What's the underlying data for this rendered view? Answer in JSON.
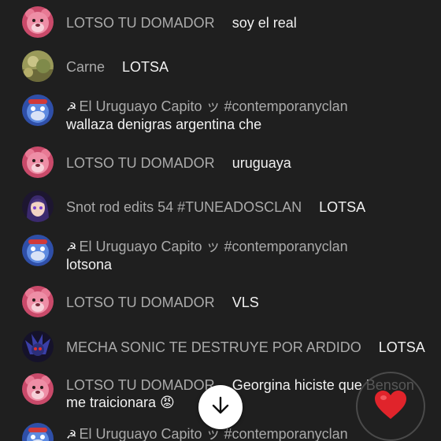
{
  "messages": [
    {
      "author": "LOTSO TU DOMADOR",
      "text": "soy el real",
      "avatar": "lotso-bear-avatar"
    },
    {
      "author": "Carne",
      "text": "LOTSA",
      "avatar": "landscape-avatar"
    },
    {
      "author": "El Uruguayo Capito ッ #contemporanyclan",
      "text": "wallaza denigras argentina che",
      "avatar": "blue-character-avatar"
    },
    {
      "author": "LOTSO TU DOMADOR",
      "text": "uruguaya",
      "avatar": "lotso-bear-avatar"
    },
    {
      "author": "Snot rod edits 54 #TUNEADOSCLAN",
      "text": "LOTSA",
      "avatar": "anime-girl-avatar"
    },
    {
      "author": "El Uruguayo Capito ッ #contemporanyclan",
      "text": "lotsona",
      "avatar": "blue-character-avatar"
    },
    {
      "author": "LOTSO TU DOMADOR",
      "text": "VLS",
      "avatar": "lotso-bear-avatar"
    },
    {
      "author": "MECHA SONIC TE DESTRUYE POR ARDIDO",
      "text": "LOTSA",
      "avatar": "mecha-sonic-avatar"
    },
    {
      "author": "LOTSO TU DOMADOR",
      "text": "Georgina hiciste que Benson",
      "text2": "me traicionara 😡",
      "avatar": "lotso-bear-avatar"
    },
    {
      "author": "El Uruguayo Capito ッ #contemporanyclan",
      "text": "",
      "avatar": "blue-character-avatar"
    }
  ],
  "hand_glyph": "☭",
  "buttons": {
    "scroll_down_icon": "arrow-down-icon",
    "reaction_icon": "heart-icon",
    "reaction_color": "#e0242b"
  },
  "colors": {
    "background": "#1f1f1f",
    "author": "#aaaaaa",
    "message": "#f1f1f1"
  }
}
